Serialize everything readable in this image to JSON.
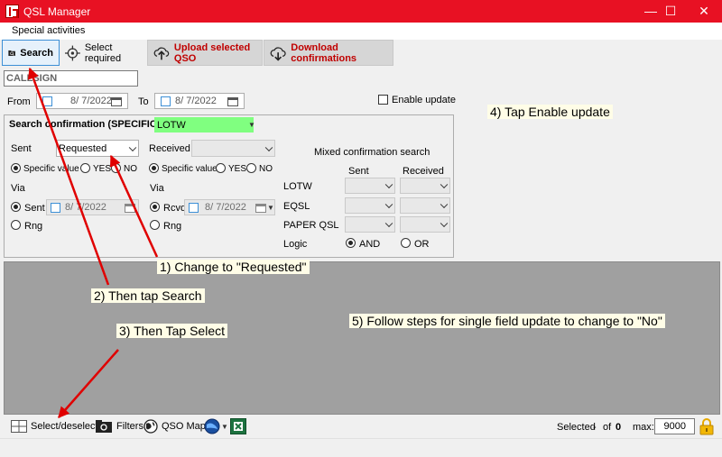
{
  "window": {
    "title": "QSL Manager",
    "minimize": "—",
    "maximize": "☐",
    "close": "✕"
  },
  "menu": {
    "special_activities": "Special activities"
  },
  "toolbar": {
    "search": "Search",
    "select_required": "Select required",
    "upload": "Upload selected QSO",
    "download": "Download confirmations"
  },
  "callsign": {
    "placeholder": "CALLSIGN",
    "value": "CALLSIGN"
  },
  "dates": {
    "from_label": "From",
    "from_value": "8/ 7/2022",
    "to_label": "To",
    "to_value": "8/ 7/2022",
    "enable_update": "Enable update"
  },
  "group": {
    "title": "Search confirmation (SPECIFIC)",
    "service": "LOTW",
    "sent_label": "Sent",
    "sent_value": "Requested",
    "received_label": "Received",
    "received_value": "",
    "specific_value": "Specific value",
    "yes": "YES",
    "no": "NO",
    "via_label": "Via",
    "sent_via": "Sent",
    "sent_via_date": "8/ 7/2022",
    "rng": "Rng",
    "rcvd": "Rcvd",
    "rcvd_date": "8/ 7/2022",
    "mixed_title": "Mixed confirmation search",
    "mixed_sent": "Sent",
    "mixed_received": "Received",
    "rows": [
      "LOTW",
      "EQSL",
      "PAPER QSL"
    ],
    "logic_label": "Logic",
    "and": "AND",
    "or": "OR"
  },
  "status": {
    "select_deselect": "Select/deselect",
    "filters": "Filters",
    "qso_map": "QSO Map",
    "selected_label": "Selected",
    "selected_dash": "-",
    "of_label": "of",
    "of_value": "0",
    "max_label": "max:",
    "max_value": "9000"
  },
  "annotations": {
    "step1": "1)  Change to \"Requested\"",
    "step2": "2)  Then tap Search",
    "step3": "3)  Then Tap Select",
    "step4": "4)  Tap Enable update",
    "step5": "5)  Follow steps for single field update to change to \"No\""
  },
  "colors": {
    "titlebar": "#e81123",
    "service_combo": "#80ff80",
    "arrow": "#e00000",
    "upload_text": "#c00000",
    "lock": "#e6a800"
  }
}
